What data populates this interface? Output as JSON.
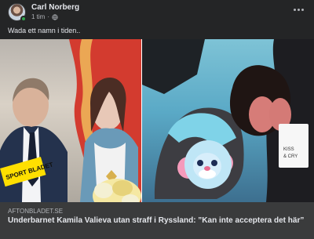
{
  "post": {
    "author": "Carl Norberg",
    "time": "1 tim",
    "separator": "·",
    "caption": "Wada ett namn i tiden..",
    "more_icon": "more-horizontal-icon",
    "privacy_icon": "globe-icon"
  },
  "images": {
    "left_logo": "SPORT BLADET"
  },
  "link": {
    "domain": "AFTONBLADET.SE",
    "title": "Underbarnet Kamila Valieva utan straff i Ryssland: ”Kan inte acceptera det här”"
  },
  "colors": {
    "background": "#242526",
    "link_box": "#3a3b3c",
    "text_primary": "#e4e6eb",
    "text_secondary": "#b0b3b8",
    "online": "#31a24c"
  }
}
